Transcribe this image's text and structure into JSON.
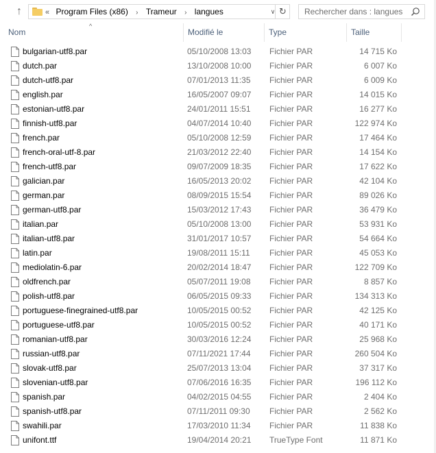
{
  "address_bar": {
    "overflow_glyph": "«",
    "crumbs": [
      "Program Files (x86)",
      "Trameur",
      "langues"
    ],
    "separator": "›",
    "dropdown_glyph": "∨",
    "refresh_glyph": "↻",
    "up_glyph": "↑"
  },
  "search": {
    "placeholder": "Rechercher dans : langues",
    "icon": "search-icon"
  },
  "columns": {
    "name": "Nom",
    "date": "Modifié le",
    "type": "Type",
    "size": "Taille",
    "sort_glyph": "^"
  },
  "files": [
    {
      "name": "bulgarian-utf8.par",
      "date": "05/10/2008 13:03",
      "type": "Fichier PAR",
      "size": "14 715 Ko"
    },
    {
      "name": "dutch.par",
      "date": "13/10/2008 10:00",
      "type": "Fichier PAR",
      "size": "6 007 Ko"
    },
    {
      "name": "dutch-utf8.par",
      "date": "07/01/2013 11:35",
      "type": "Fichier PAR",
      "size": "6 009 Ko"
    },
    {
      "name": "english.par",
      "date": "16/05/2007 09:07",
      "type": "Fichier PAR",
      "size": "14 015 Ko"
    },
    {
      "name": "estonian-utf8.par",
      "date": "24/01/2011 15:51",
      "type": "Fichier PAR",
      "size": "16 277 Ko"
    },
    {
      "name": "finnish-utf8.par",
      "date": "04/07/2014 10:40",
      "type": "Fichier PAR",
      "size": "122 974 Ko"
    },
    {
      "name": "french.par",
      "date": "05/10/2008 12:59",
      "type": "Fichier PAR",
      "size": "17 464 Ko"
    },
    {
      "name": "french-oral-utf-8.par",
      "date": "21/03/2012 22:40",
      "type": "Fichier PAR",
      "size": "14 154 Ko"
    },
    {
      "name": "french-utf8.par",
      "date": "09/07/2009 18:35",
      "type": "Fichier PAR",
      "size": "17 622 Ko"
    },
    {
      "name": "galician.par",
      "date": "16/05/2013 20:02",
      "type": "Fichier PAR",
      "size": "42 104 Ko"
    },
    {
      "name": "german.par",
      "date": "08/09/2015 15:54",
      "type": "Fichier PAR",
      "size": "89 026 Ko"
    },
    {
      "name": "german-utf8.par",
      "date": "15/03/2012 17:43",
      "type": "Fichier PAR",
      "size": "36 479 Ko"
    },
    {
      "name": "italian.par",
      "date": "05/10/2008 13:00",
      "type": "Fichier PAR",
      "size": "53 931 Ko"
    },
    {
      "name": "italian-utf8.par",
      "date": "31/01/2017 10:57",
      "type": "Fichier PAR",
      "size": "54 664 Ko"
    },
    {
      "name": "latin.par",
      "date": "19/08/2011 15:11",
      "type": "Fichier PAR",
      "size": "45 053 Ko"
    },
    {
      "name": "mediolatin-6.par",
      "date": "20/02/2014 18:47",
      "type": "Fichier PAR",
      "size": "122 709 Ko"
    },
    {
      "name": "oldfrench.par",
      "date": "05/07/2011 19:08",
      "type": "Fichier PAR",
      "size": "8 857 Ko"
    },
    {
      "name": "polish-utf8.par",
      "date": "06/05/2015 09:33",
      "type": "Fichier PAR",
      "size": "134 313 Ko"
    },
    {
      "name": "portuguese-finegrained-utf8.par",
      "date": "10/05/2015 00:52",
      "type": "Fichier PAR",
      "size": "42 125 Ko"
    },
    {
      "name": "portuguese-utf8.par",
      "date": "10/05/2015 00:52",
      "type": "Fichier PAR",
      "size": "40 171 Ko"
    },
    {
      "name": "romanian-utf8.par",
      "date": "30/03/2016 12:24",
      "type": "Fichier PAR",
      "size": "25 968 Ko"
    },
    {
      "name": "russian-utf8.par",
      "date": "07/11/2021 17:44",
      "type": "Fichier PAR",
      "size": "260 504 Ko"
    },
    {
      "name": "slovak-utf8.par",
      "date": "25/07/2013 13:04",
      "type": "Fichier PAR",
      "size": "37 317 Ko"
    },
    {
      "name": "slovenian-utf8.par",
      "date": "07/06/2016 16:35",
      "type": "Fichier PAR",
      "size": "196 112 Ko"
    },
    {
      "name": "spanish.par",
      "date": "04/02/2015 04:55",
      "type": "Fichier PAR",
      "size": "2 404 Ko"
    },
    {
      "name": "spanish-utf8.par",
      "date": "07/11/2011 09:30",
      "type": "Fichier PAR",
      "size": "2 562 Ko"
    },
    {
      "name": "swahili.par",
      "date": "17/03/2010 11:34",
      "type": "Fichier PAR",
      "size": "11 838 Ko"
    },
    {
      "name": "unifont.ttf",
      "date": "19/04/2014 20:21",
      "type": "TrueType Font",
      "size": "11 871 Ko"
    }
  ],
  "colors": {
    "header_text": "#4c607a",
    "secondary_text": "#6d6d6d",
    "folder_icon": "#f5cd64"
  }
}
